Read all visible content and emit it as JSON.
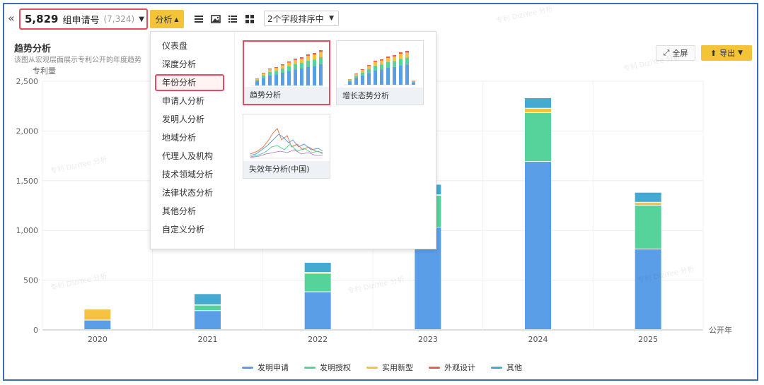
{
  "toolbar": {
    "collapse_glyph": "«",
    "count": "5,829",
    "count_unit": "组申请号",
    "count_sub": "(7,324)",
    "analysis_label": "分析",
    "sort_label": "2个字段排序中"
  },
  "section": {
    "title": "趋势分析",
    "description": "该图从宏观层面展示专利公开的年度趋势",
    "fullscreen_label": "全屏",
    "export_label": "导出"
  },
  "watermark_text": "专利 DiziYee 分析",
  "menu": {
    "items": [
      "仪表盘",
      "深度分析",
      "年份分析",
      "申请人分析",
      "发明人分析",
      "地域分析",
      "代理人及机构",
      "技术领域分析",
      "法律状态分析",
      "其他分析",
      "自定义分析"
    ],
    "active_index": 2,
    "cards": [
      "趋势分析",
      "增长态势分析",
      "失效年分析(中国)"
    ],
    "active_card": 0
  },
  "colors": {
    "accent": "#f3c437",
    "highlight": "#e84a5f",
    "invention_application": "#5b9ee8",
    "invention_grant": "#56d39b",
    "utility_model": "#f5c244",
    "design": "#ef5b5b",
    "other": "#44aad2"
  },
  "chart_data": {
    "type": "bar",
    "stacked": true,
    "ylabel": "专利量",
    "xlabel": "公开年",
    "categories": [
      "2020",
      "2021",
      "2022",
      "2023",
      "2024",
      "2025"
    ],
    "ylim": [
      0,
      2500
    ],
    "yticks": [
      0,
      500,
      1000,
      1500,
      2000,
      2500
    ],
    "ytick_labels": [
      "0",
      "500",
      "1,000",
      "1,500",
      "2,000",
      "2,500"
    ],
    "grid": true,
    "legend_position": "bottom",
    "series": [
      {
        "name": "发明申请",
        "values": [
          95,
          190,
          380,
          1030,
          1690,
          810
        ]
      },
      {
        "name": "发明授权",
        "values": [
          0,
          55,
          185,
          320,
          490,
          440
        ]
      },
      {
        "name": "实用新型",
        "values": [
          110,
          5,
          10,
          5,
          45,
          30
        ]
      },
      {
        "name": "外观设计",
        "values": [
          0,
          0,
          0,
          0,
          0,
          0
        ]
      },
      {
        "name": "其他",
        "values": [
          0,
          110,
          100,
          105,
          105,
          100
        ]
      }
    ]
  }
}
